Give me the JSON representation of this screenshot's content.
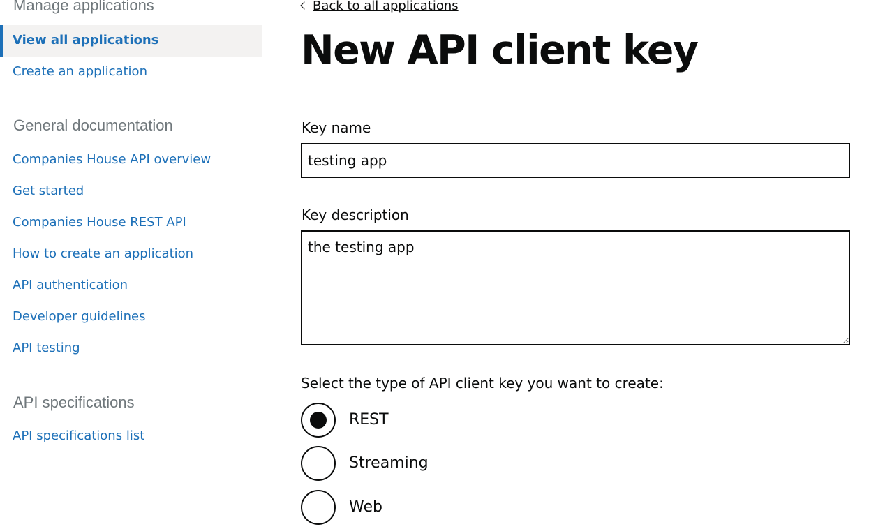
{
  "sidebar": {
    "manage_heading": "Manage applications",
    "manage_items": [
      {
        "label": "View all applications",
        "active": true
      },
      {
        "label": "Create an application"
      }
    ],
    "docs_heading": "General documentation",
    "docs_items": [
      {
        "label": "Companies House API overview"
      },
      {
        "label": "Get started"
      },
      {
        "label": "Companies House REST API"
      },
      {
        "label": "How to create an application"
      },
      {
        "label": "API authentication"
      },
      {
        "label": "Developer guidelines"
      },
      {
        "label": "API testing"
      }
    ],
    "specs_heading": "API specifications",
    "specs_items": [
      {
        "label": "API specifications list"
      }
    ]
  },
  "main": {
    "back_link": "Back to all applications",
    "title": "New API client key",
    "key_name": {
      "label": "Key name",
      "value": "testing app"
    },
    "key_description": {
      "label": "Key description",
      "value": "the testing app"
    },
    "key_type": {
      "legend": "Select the type of API client key you want to create:",
      "options": [
        {
          "label": "REST",
          "checked": true
        },
        {
          "label": "Streaming",
          "checked": false
        },
        {
          "label": "Web",
          "checked": false
        }
      ]
    }
  },
  "colors": {
    "link": "#1d70b8",
    "text": "#0b0c0c",
    "muted_heading": "#6f777b",
    "active_bg": "#f3f2f1"
  }
}
